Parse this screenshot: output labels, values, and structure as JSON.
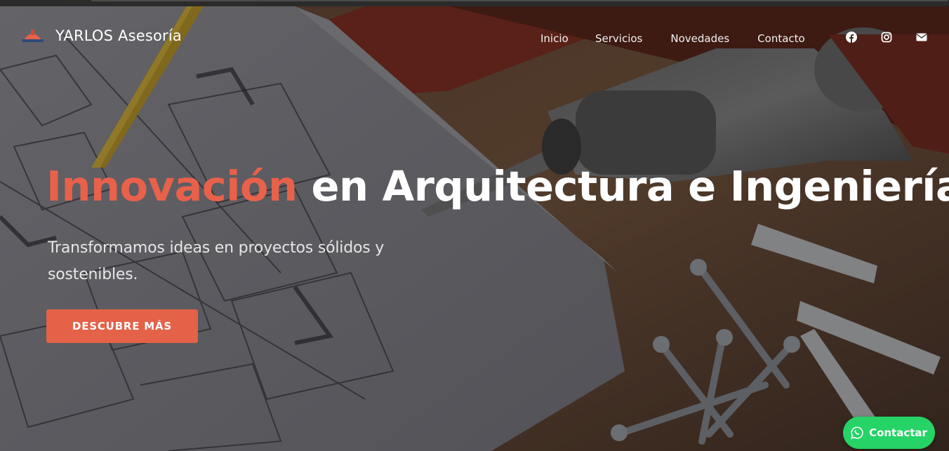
{
  "brand": {
    "name": "YARLOS Asesoría",
    "logo_icon": "hardhat-icon"
  },
  "nav": {
    "items": [
      "Inicio",
      "Servicios",
      "Novedades",
      "Contacto"
    ]
  },
  "socials": [
    "facebook-icon",
    "instagram-icon",
    "envelope-icon"
  ],
  "hero": {
    "headline_accent": "Innovación",
    "headline_rest": " en Arquitectura e Ingeniería",
    "subtitle": "Transformamos ideas en proyectos sólidos y sostenibles.",
    "cta_label": "DESCUBRE MÁS"
  },
  "whatsapp": {
    "label": "Contactar",
    "icon": "whatsapp-icon"
  },
  "colors": {
    "accent": "#e8614a",
    "cta": "#e36248",
    "whatsapp": "#25d366"
  }
}
